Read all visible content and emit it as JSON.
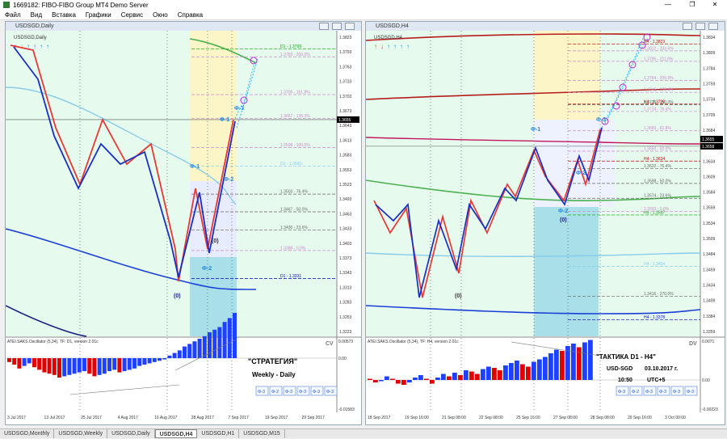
{
  "window": {
    "title": "1669182: FIBO-FIBO Group MT4 Demo Server"
  },
  "menu": [
    "Файл",
    "Вид",
    "Вставка",
    "Графики",
    "Сервис",
    "Окно",
    "Справка"
  ],
  "left_window": {
    "title": "USDSGD,Daily",
    "chart_label": "USDSGD,Daily",
    "price_ticks": [
      "1.3823",
      "1.3793",
      "1.3763",
      "1.3733",
      "1.3703",
      "1.3673",
      "1.3643",
      "1.3613",
      "1.3583",
      "1.3553",
      "1.3523",
      "1.3493",
      "1.3463",
      "1.3433",
      "1.3403",
      "1.3373",
      "1.3343",
      "1.3313",
      "1.3283",
      "1.3253",
      "1.3223"
    ],
    "current_price": "1.3655",
    "level_labels": [
      {
        "text": "D1 - 1.3799",
        "color": "#00aa00",
        "price": 1.3799
      },
      {
        "text": "1.3783 - 200.0%",
        "color": "#cc88cc",
        "price": 1.3783
      },
      {
        "text": "1.3706 - 161.8%",
        "color": "#cc88cc",
        "price": 1.3706
      },
      {
        "text": "1.3657 - 138.2%",
        "color": "#cc88cc",
        "price": 1.3657
      },
      {
        "text": "1.3598 - 100.0%",
        "color": "#cc88cc",
        "price": 1.3598
      },
      {
        "text": "D1 - 1.3560",
        "color": "#88ccee",
        "price": 1.356
      },
      {
        "text": "1.3503 - 76.4%",
        "color": "#666666",
        "price": 1.3503
      },
      {
        "text": "1.3467 - 50.0%",
        "color": "#666666",
        "price": 1.3467
      },
      {
        "text": "1.3430 - 23.6%",
        "color": "#666666",
        "price": 1.343
      },
      {
        "text": "1.3388 - 0.0%",
        "color": "#cc88cc",
        "price": 1.3388
      },
      {
        "text": "D1 - 1.3331",
        "color": "#0000cc",
        "price": 1.3331
      }
    ],
    "wave_labels": [
      {
        "text": "Ф-1",
        "color": "#1e88e5"
      },
      {
        "text": "Ф-1",
        "color": "#1e88e5"
      },
      {
        "text": "Ф-3",
        "color": "#1e88e5"
      },
      {
        "text": "Ф-2",
        "color": "#1e88e5"
      },
      {
        "text": "Ф-2",
        "color": "#1e88e5"
      },
      {
        "text": "(0)",
        "color": "#333333"
      },
      {
        "text": "(0)",
        "color": "#1a237e"
      }
    ],
    "indicator_label": "ATEI.SAKS.Oscillator (5,34), TF: D1,  version 2.01c",
    "indicator_ticks": [
      "0.00573",
      "0.00",
      "-0.01583"
    ],
    "indicator_corner": "CV",
    "strategy_title": "\"СТРАТЕГИЯ\"",
    "strategy_sub": "Weekly - Daily",
    "buttons": [
      "Ф-3",
      "Ф-2",
      "Ф-3",
      "Ф-3",
      "Ф-3",
      "Ф-3"
    ],
    "dates": [
      "3 Jul 2017",
      "13 Jul 2017",
      "25 Jul 2017",
      "4 Aug 2017",
      "16 Aug 2017",
      "28 Aug 2017",
      "7 Sep 2017",
      "19 Sep 2017",
      "29 Sep 2017"
    ]
  },
  "right_window": {
    "title": "USDSGD,H4",
    "chart_label": "USDSGD,H4",
    "price_ticks": [
      "1.3834",
      "1.3809",
      "1.3784",
      "1.3759",
      "1.3734",
      "1.3709",
      "1.3684",
      "1.3659",
      "1.3634",
      "1.3609",
      "1.3584",
      "1.3559",
      "1.3534",
      "1.3509",
      "1.3484",
      "1.3459",
      "1.3434",
      "1.3409",
      "1.3384",
      "1.3359"
    ],
    "current_price": "1.3658",
    "current_price2": "1.3655",
    "level_labels": [
      {
        "text": "H4 - 1.3823",
        "color": "#cc0000",
        "price": 1.3823
      },
      {
        "text": "1.3812 - 233.6%",
        "color": "#cc88cc",
        "price": 1.3812
      },
      {
        "text": "1.3795 - 211.8%",
        "color": "#cc88cc",
        "price": 1.3795
      },
      {
        "text": "1.3764 - 200.0%",
        "color": "#cc88cc",
        "price": 1.3764
      },
      {
        "text": "1.3745 - 176.4%",
        "color": "#cc88cc",
        "price": 1.3745
      },
      {
        "text": "H4 - 1.3726",
        "color": "#cc0000",
        "price": 1.3726
      },
      {
        "text": "1.3725 - 150.0%",
        "color": "#666666",
        "price": 1.3725
      },
      {
        "text": "1.3714 - 76.4%",
        "color": "#cc88cc",
        "price": 1.3714
      },
      {
        "text": "1.3683 - 61.8%",
        "color": "#cc88cc",
        "price": 1.3683
      },
      {
        "text": "1.3650 - 50.0%",
        "color": "#cc88cc",
        "price": 1.365
      },
      {
        "text": "H4 - 1.3634",
        "color": "#cc0000",
        "price": 1.3634
      },
      {
        "text": "1.3622 - 76.4%",
        "color": "#666666",
        "price": 1.3622
      },
      {
        "text": "1.3598 - 50.0%",
        "color": "#666666",
        "price": 1.3598
      },
      {
        "text": "1.3574 - 23.6%",
        "color": "#666666",
        "price": 1.3574
      },
      {
        "text": "H4 - 1.3547",
        "color": "#00aa00",
        "price": 1.3547
      },
      {
        "text": "1.3553 - 0.0%",
        "color": "#cc88cc",
        "price": 1.3553
      },
      {
        "text": "H4 - 1.3464",
        "color": "#88ccee",
        "price": 1.3464
      },
      {
        "text": "1.3416 - 270.0%",
        "color": "#666666",
        "price": 1.3416
      },
      {
        "text": "H4 - 1.3378",
        "color": "#0000cc",
        "price": 1.3378
      }
    ],
    "wave_labels": [
      {
        "text": "Ф-1",
        "color": "#1e88e5"
      },
      {
        "text": "Ф-3",
        "color": "#1e88e5"
      },
      {
        "text": "Ф-2",
        "color": "#1e88e5"
      },
      {
        "text": "Ф-2",
        "color": "#1e88e5"
      },
      {
        "text": "(0)",
        "color": "#333333"
      },
      {
        "text": "(0)",
        "color": "#1a237e"
      }
    ],
    "indicator_label": "ATEI.SAKS.Oscillator (5,34), TF: H4,  version 2.01c",
    "indicator_ticks": [
      "0.0071",
      "0.00",
      "-0.00223"
    ],
    "indicator_corner": "DV",
    "tactic_title": "\"ТАКТИКА  D1 - H4\"",
    "tactic_symbol": "USD-SGD",
    "tactic_date": "03.10.2017 г.",
    "tactic_time": "10:50",
    "tactic_tz": "UTC+5",
    "buttons": [
      "Ф-3",
      "Ф-2",
      "Ф-3",
      "Ф-3",
      "Ф-3",
      "Ф-3"
    ],
    "dates": [
      "18 Sep 2017",
      "19 Sep 16:00",
      "21 Sep 08:00",
      "22 Sep 08:00",
      "25 Sep 16:00",
      "27 Sep 08:00",
      "28 Sep 08:00",
      "29 Sep 16:00",
      "3 Oct 00:00"
    ]
  },
  "tabs": [
    "USDSGD,Monthly",
    "USDSGD,Weekly",
    "USDSGD,Daily",
    "USDSGD,H4",
    "USDSGD,H1",
    "USDSGD,M15"
  ],
  "active_tab": "USDSGD,H4"
}
